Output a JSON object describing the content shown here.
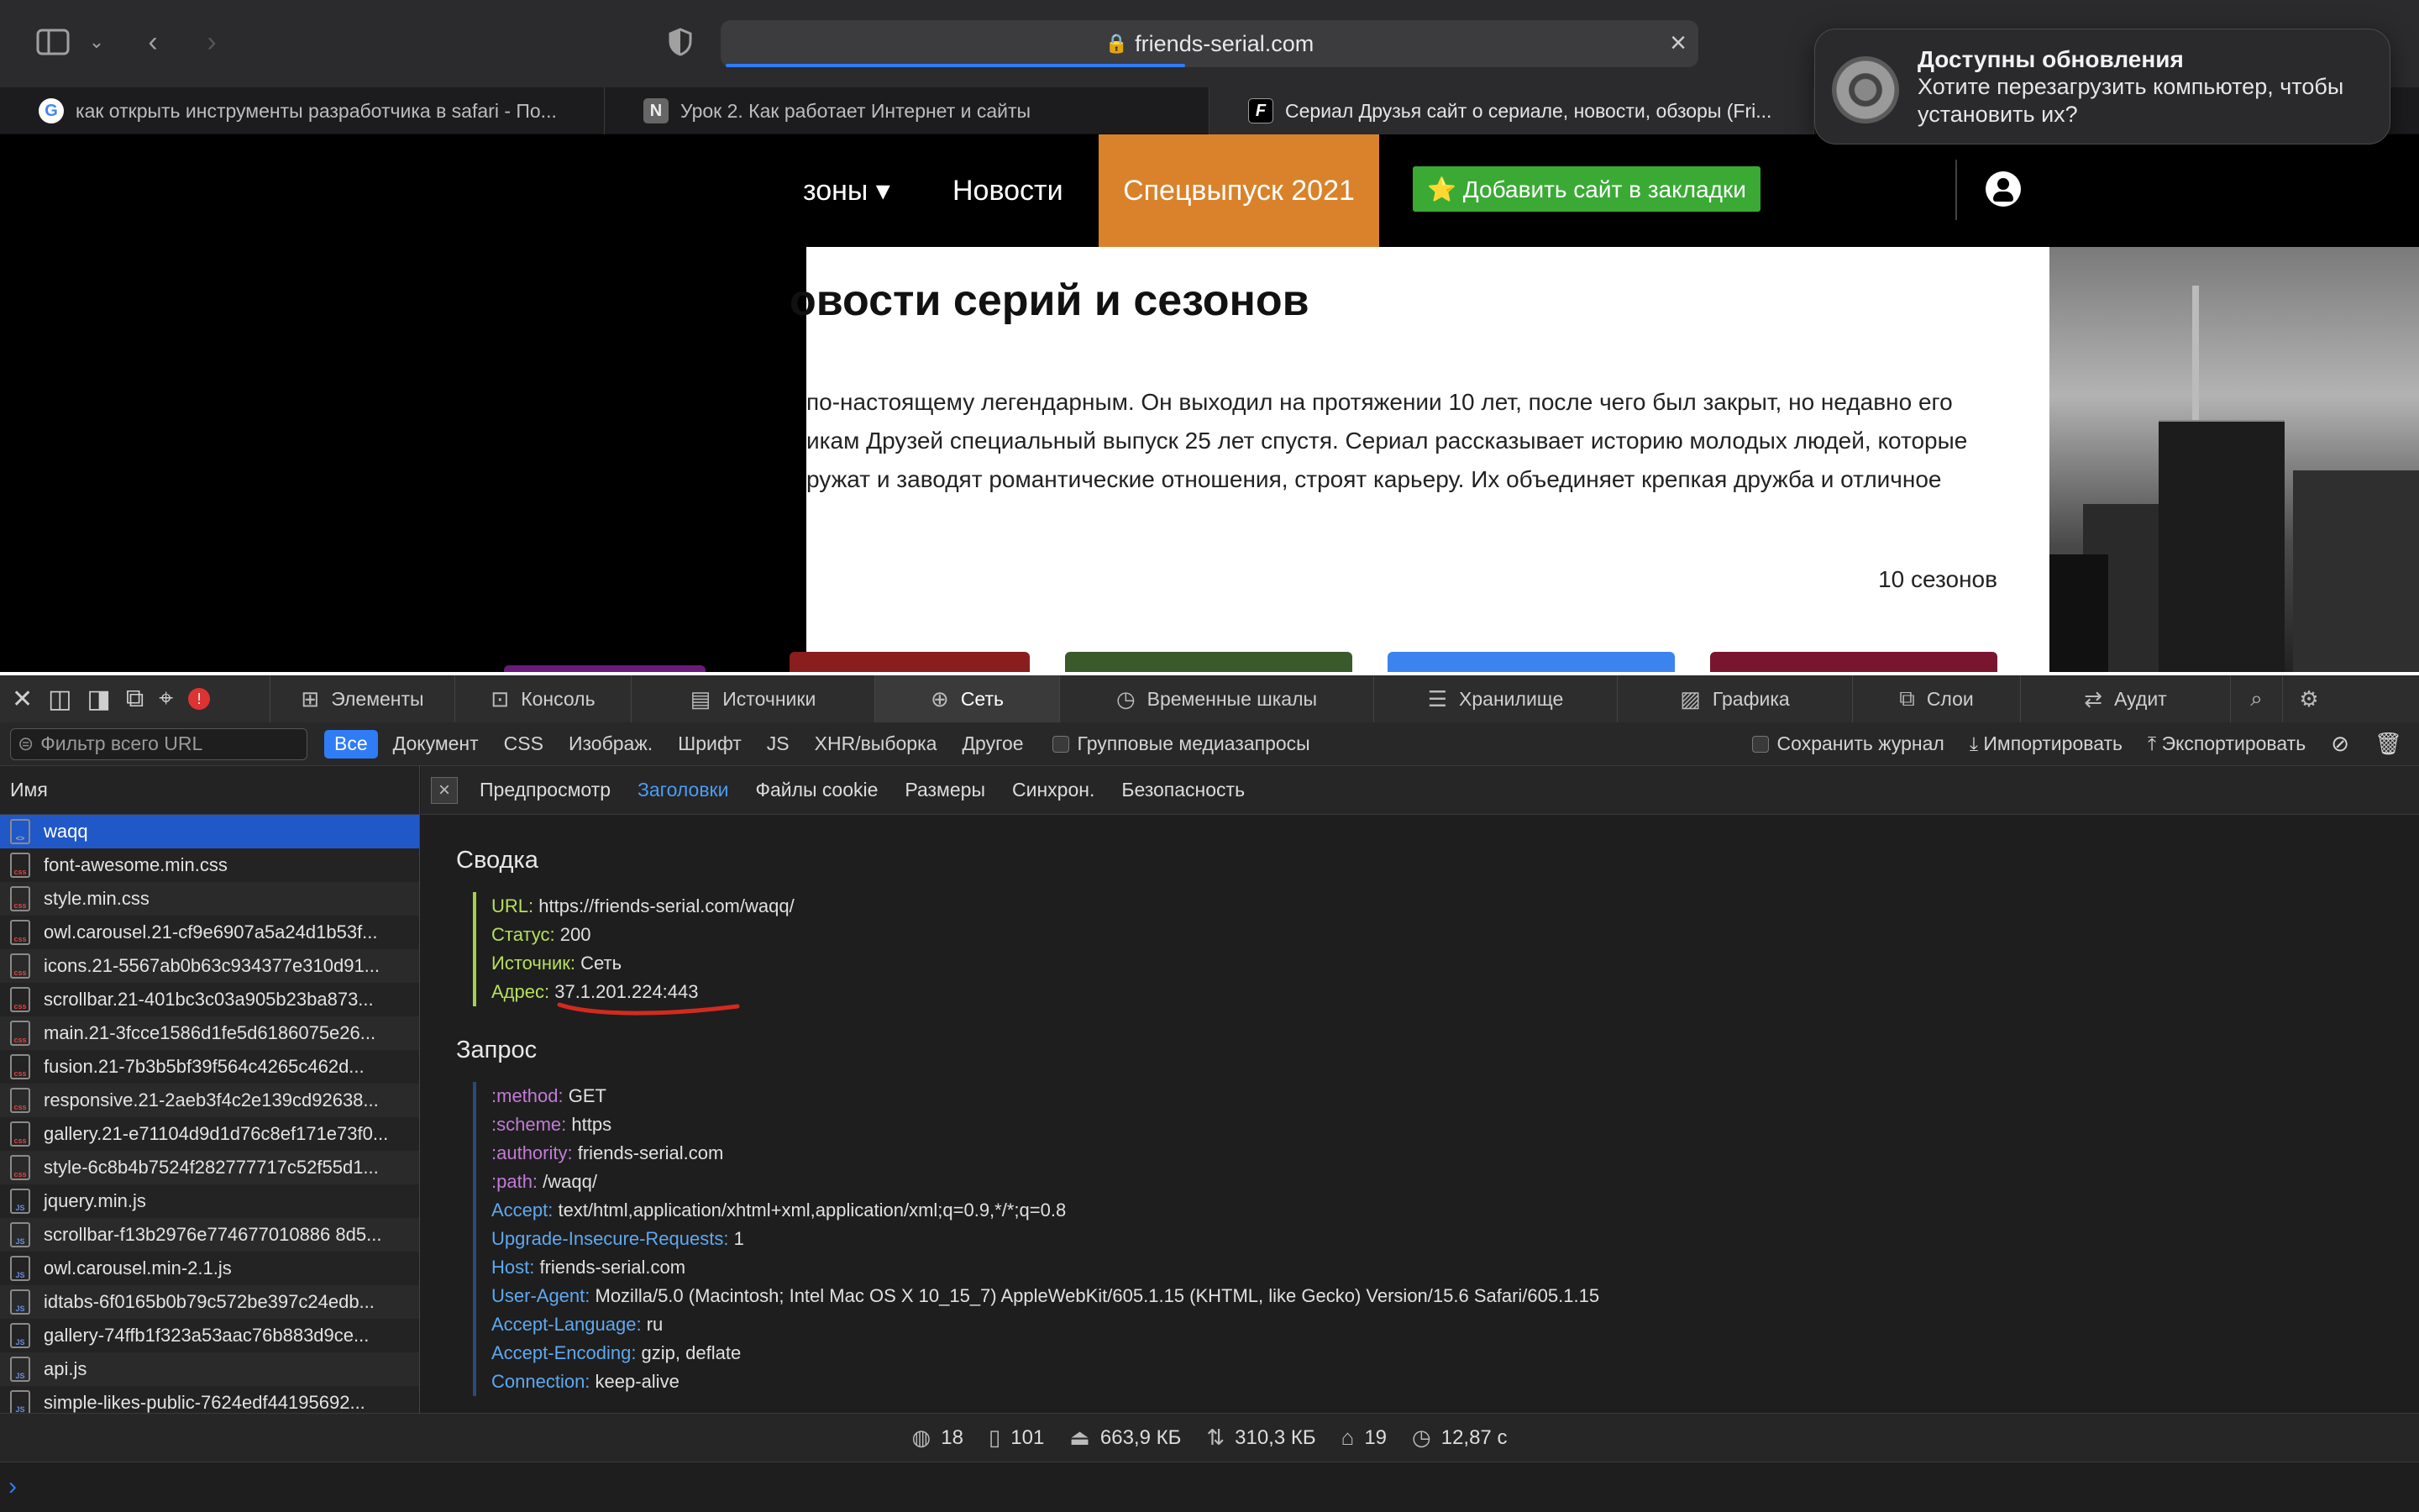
{
  "browser": {
    "url": "friends-serial.com",
    "tabs": [
      {
        "title": "как открыть инструменты разработчика в safari - По...",
        "favicon": "G",
        "active": false
      },
      {
        "title": "Урок 2. Как работает Интернет и сайты",
        "favicon": "N",
        "active": false
      },
      {
        "title": "Сериал Друзья сайт о сериале, новости, обзоры (Fri...",
        "favicon": "F",
        "active": true
      }
    ]
  },
  "notification": {
    "title": "Доступны обновления",
    "body": "Хотите перезагрузить компьютер, чтобы установить их?"
  },
  "website": {
    "nav": {
      "seasons": "зоны ▾",
      "news": "Новости",
      "special": "Спецвыпуск 2021",
      "bookmark": "⭐ Добавить сайт в закладки"
    },
    "heading": "овости серий и сезонов",
    "lines": [
      "по-настоящему легендарным. Он выходил на протяжении 10 лет, после чего был закрыт, но недавно его",
      "икам Друзей специальный выпуск 25 лет спустя. Сериал рассказывает историю молодых людей, которые",
      "ружат и заводят романтические отношения, строят карьеру. Их объединяет крепкая дружба и отличное"
    ],
    "seasons_count": "10 сезонов"
  },
  "devtools": {
    "tabs": [
      {
        "label": "Элементы",
        "icon": "elements-icon",
        "active": false
      },
      {
        "label": "Консоль",
        "icon": "console-icon",
        "active": false
      },
      {
        "label": "Источники",
        "icon": "sources-icon",
        "active": false
      },
      {
        "label": "Сеть",
        "icon": "network-icon",
        "active": true
      },
      {
        "label": "Временные шкалы",
        "icon": "timeline-icon",
        "active": false
      },
      {
        "label": "Хранилище",
        "icon": "storage-icon",
        "active": false
      },
      {
        "label": "Графика",
        "icon": "graphics-icon",
        "active": false
      },
      {
        "label": "Слои",
        "icon": "layers-icon",
        "active": false
      },
      {
        "label": "Аудит",
        "icon": "audit-icon",
        "active": false
      }
    ],
    "filter": {
      "placeholder": "Фильтр всего URL",
      "types": [
        "Все",
        "Документ",
        "CSS",
        "Изображ.",
        "Шрифт",
        "JS",
        "XHR/выборка",
        "Другое"
      ],
      "group_media": "Групповые медиазапросы",
      "preserve_log": "Сохранить журнал",
      "import": "Импортировать",
      "export": "Экспортировать"
    },
    "list_header": "Имя",
    "resources": [
      {
        "name": "waqq",
        "type": "doc"
      },
      {
        "name": "font-awesome.min.css",
        "type": "css"
      },
      {
        "name": "style.min.css",
        "type": "css"
      },
      {
        "name": "owl.carousel.21-cf9e6907a5a24d1b53f...",
        "type": "css"
      },
      {
        "name": "icons.21-5567ab0b63c934377e310d91...",
        "type": "css"
      },
      {
        "name": "scrollbar.21-401bc3c03a905b23ba873...",
        "type": "css"
      },
      {
        "name": "main.21-3fcce1586d1fe5d6186075e26...",
        "type": "css"
      },
      {
        "name": "fusion.21-7b3b5bf39f564c4265c462d...",
        "type": "css"
      },
      {
        "name": "responsive.21-2aeb3f4c2e139cd92638...",
        "type": "css"
      },
      {
        "name": "gallery.21-e71104d9d1d76c8ef171e73f0...",
        "type": "css"
      },
      {
        "name": "style-6c8b4b7524f282777717c52f55d1...",
        "type": "css"
      },
      {
        "name": "jquery.min.js",
        "type": "js"
      },
      {
        "name": "scrollbar-f13b2976e774677010886 8d5...",
        "type": "js"
      },
      {
        "name": "owl.carousel.min-2.1.js",
        "type": "js"
      },
      {
        "name": "idtabs-6f0165b0b79c572be397c24edb...",
        "type": "js"
      },
      {
        "name": "gallery-74ffb1f323a53aac76b883d9ce...",
        "type": "js"
      },
      {
        "name": "api.js",
        "type": "js"
      },
      {
        "name": "simple-likes-public-7624edf44195692...",
        "type": "js"
      }
    ],
    "subtabs": [
      "Предпросмотр",
      "Заголовки",
      "Файлы cookie",
      "Размеры",
      "Синхрон.",
      "Безопасность"
    ],
    "summary_title": "Сводка",
    "summary": [
      {
        "k": "URL:",
        "v": "https://friends-serial.com/waqq/"
      },
      {
        "k": "Статус:",
        "v": "200"
      },
      {
        "k": "Источник:",
        "v": "Сеть"
      },
      {
        "k": "Адрес:",
        "v": "37.1.201.224:443"
      }
    ],
    "request_title": "Запрос",
    "request": [
      {
        "k": ":method:",
        "v": "GET",
        "c": "k2"
      },
      {
        "k": ":scheme:",
        "v": "https",
        "c": "k2"
      },
      {
        "k": ":authority:",
        "v": "friends-serial.com",
        "c": "k2"
      },
      {
        "k": ":path:",
        "v": "/waqq/",
        "c": "k2"
      },
      {
        "k": "Accept:",
        "v": "text/html,application/xhtml+xml,application/xml;q=0.9,*/*;q=0.8",
        "c": "k3"
      },
      {
        "k": "Upgrade-Insecure-Requests:",
        "v": "1",
        "c": "k3"
      },
      {
        "k": "Host:",
        "v": "friends-serial.com",
        "c": "k3"
      },
      {
        "k": "User-Agent:",
        "v": "Mozilla/5.0 (Macintosh; Intel Mac OS X 10_15_7) AppleWebKit/605.1.15 (KHTML, like Gecko) Version/15.6 Safari/605.1.15",
        "c": "k3"
      },
      {
        "k": "Accept-Language:",
        "v": "ru",
        "c": "k3"
      },
      {
        "k": "Accept-Encoding:",
        "v": "gzip, deflate",
        "c": "k3"
      },
      {
        "k": "Connection:",
        "v": "keep-alive",
        "c": "k3"
      }
    ],
    "status_bar": [
      {
        "icon": "globe-icon",
        "value": "18"
      },
      {
        "icon": "document-icon",
        "value": "101"
      },
      {
        "icon": "weight-icon",
        "value": "663,9 КБ"
      },
      {
        "icon": "transfer-icon",
        "value": "310,3 КБ"
      },
      {
        "icon": "requests-icon",
        "value": "19"
      },
      {
        "icon": "clock-icon",
        "value": "12,87 с"
      }
    ]
  }
}
